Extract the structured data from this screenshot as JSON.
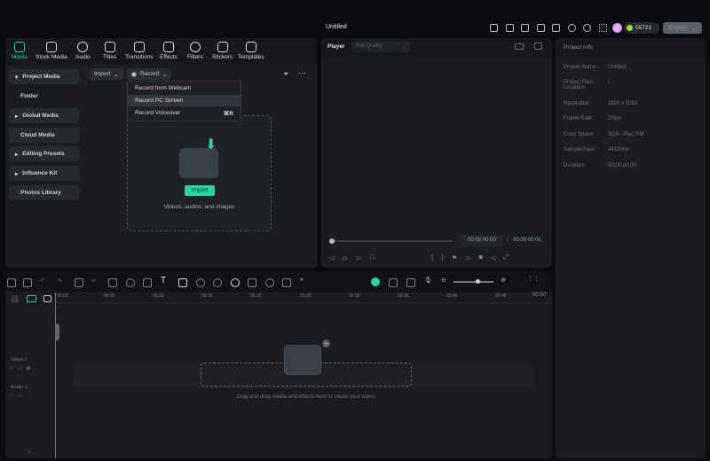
{
  "window": {
    "title": "Untitled"
  },
  "header": {
    "credits": "55721",
    "export_label": "Export",
    "icons": [
      "gift-icon",
      "send-icon",
      "storage-icon",
      "layout-icon",
      "save-icon",
      "cloud-icon",
      "support-icon",
      "apps-icon"
    ]
  },
  "media_tabs": [
    {
      "label": "Media"
    },
    {
      "label": "Stock Media"
    },
    {
      "label": "Audio"
    },
    {
      "label": "Titles"
    },
    {
      "label": "Transitions"
    },
    {
      "label": "Effects"
    },
    {
      "label": "Filters"
    },
    {
      "label": "Stickers"
    },
    {
      "label": "Templates"
    }
  ],
  "sidebar": {
    "items": [
      {
        "label": "Project Media"
      },
      {
        "label": "Folder"
      },
      {
        "label": "Global Media"
      },
      {
        "label": "Cloud Media"
      },
      {
        "label": "Editing Presets"
      },
      {
        "label": "Influence Kit"
      },
      {
        "label": "Photos Library"
      }
    ]
  },
  "media": {
    "import_label": "Import",
    "record_label": "Record",
    "record_menu": [
      {
        "label": "Record from Webcam",
        "shortcut": ""
      },
      {
        "label": "Record PC Screen",
        "shortcut": ""
      },
      {
        "label": "Record Voiceover",
        "shortcut": "⌘R"
      }
    ],
    "drop_import": "Import",
    "drop_hint": "Videos, audios, and images"
  },
  "player": {
    "label": "Player",
    "quality": "Full Quality",
    "time_current": "00:00:00:00",
    "time_total": "00:00:00:00",
    "progress": 0
  },
  "project_info": {
    "title": "Project Info",
    "rows": [
      {
        "k": "Project Name:",
        "v": "Untitled"
      },
      {
        "k": "Project Files Location:",
        "v": "/"
      },
      {
        "k": "Resolution:",
        "v": "1920 x 1080"
      },
      {
        "k": "Frame Rate:",
        "v": "25fps"
      },
      {
        "k": "Color Space:",
        "v": "SDR - Rec.709"
      },
      {
        "k": "Sample Rate:",
        "v": "44100Hz"
      },
      {
        "k": "Duration:",
        "v": "00:00:00:00"
      }
    ]
  },
  "timeline": {
    "ticks": [
      "00:00",
      "00:05",
      "00:10",
      "00:15",
      "00:20",
      "00:25",
      "00:30",
      "00:35",
      "00:40",
      "00:45",
      "00:50"
    ],
    "tracks": [
      {
        "label": "Video 1"
      },
      {
        "label": "Audio 1"
      }
    ],
    "drop_hint": "Drag and drop media and effects here to create your video.",
    "zoom_level": 0.6
  },
  "colors": {
    "accent": "#29d6a3",
    "bg": "#0a0c0f",
    "panel": "#1b1d21"
  }
}
